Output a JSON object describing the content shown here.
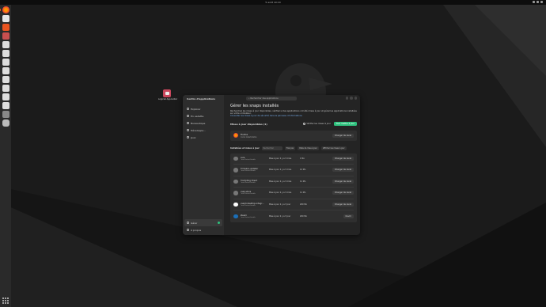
{
  "topbar": {
    "clock": "5 août 10:10"
  },
  "desktop": {
    "icon_label": "Logiciel Appcenter"
  },
  "window": {
    "sidebar": {
      "title": "Centre d'applications",
      "items": [
        {
          "label": "Explorer"
        },
        {
          "label": "En vedette"
        },
        {
          "label": "Bureautique"
        },
        {
          "label": "Développe..."
        },
        {
          "label": "Jeux"
        }
      ],
      "bottom": [
        {
          "label": "Gérer"
        },
        {
          "label": "À propos"
        }
      ]
    },
    "search_placeholder": "Rechercher des applications",
    "main": {
      "title": "Gérer les snaps installés",
      "description": "Recherchez les mises à jour disponibles, vérifiez si des applications ont été mises à jour et gérez les applications installées sur votre ordinateur.",
      "link": "Consulter les mises à jour de sécurité dans le panneau d'informations",
      "available_label": "Mises à jour disponibles (1)",
      "refresh_label": "Vérifier les mises à jour",
      "update_all_label": "Tout mettre à jour",
      "update_card": {
        "name": "Firefox",
        "sub": "Canal latest/stable",
        "channel": "Changer de canal"
      },
      "installed_label": "Installées et mises à jour",
      "filter_placeholder": "Rechercher",
      "sort_label": "Trier par",
      "sort_value": "Date de mise à jour",
      "filter_chip": "Afficher les mises à jour",
      "rows": [
        {
          "name": "bare",
          "sub": "Canal latest/stable",
          "date": "Mise à jour il y a 3 mois",
          "size": "1 Mo",
          "button": "Changer de canal"
        },
        {
          "name": "firmware-updater",
          "sub": "Canal latest/stable",
          "date": "Mise à jour il y a 3 mois",
          "size": "12 Mo",
          "button": "Changer de canal"
        },
        {
          "name": "Prompting Client",
          "sub": "Canal latest/stable",
          "date": "Mise à jour il y a 3 mois",
          "size": "11 Mo",
          "button": "Changer de canal"
        },
        {
          "name": "snap-store",
          "sub": "Canal latest/stable",
          "date": "Mise à jour il y a 3 mois",
          "size": "11 Mo",
          "button": "Changer de canal"
        },
        {
          "name": "snapd-desktop-integr...",
          "sub": "Canal latest/stable",
          "date": "Mise à jour il y a 3 jour",
          "size": "200 Mo",
          "button": "Changer de canal"
        },
        {
          "name": "Steam",
          "sub": "Canal latest/stable",
          "date": "Mise à jour il y a 3 jour",
          "size": "200 Mo",
          "button": "Ouvrir"
        }
      ]
    }
  },
  "colors": {
    "accent_green": "#2ec27e",
    "ubuntu_orange": "#e95420",
    "link_blue": "#78aeed"
  }
}
